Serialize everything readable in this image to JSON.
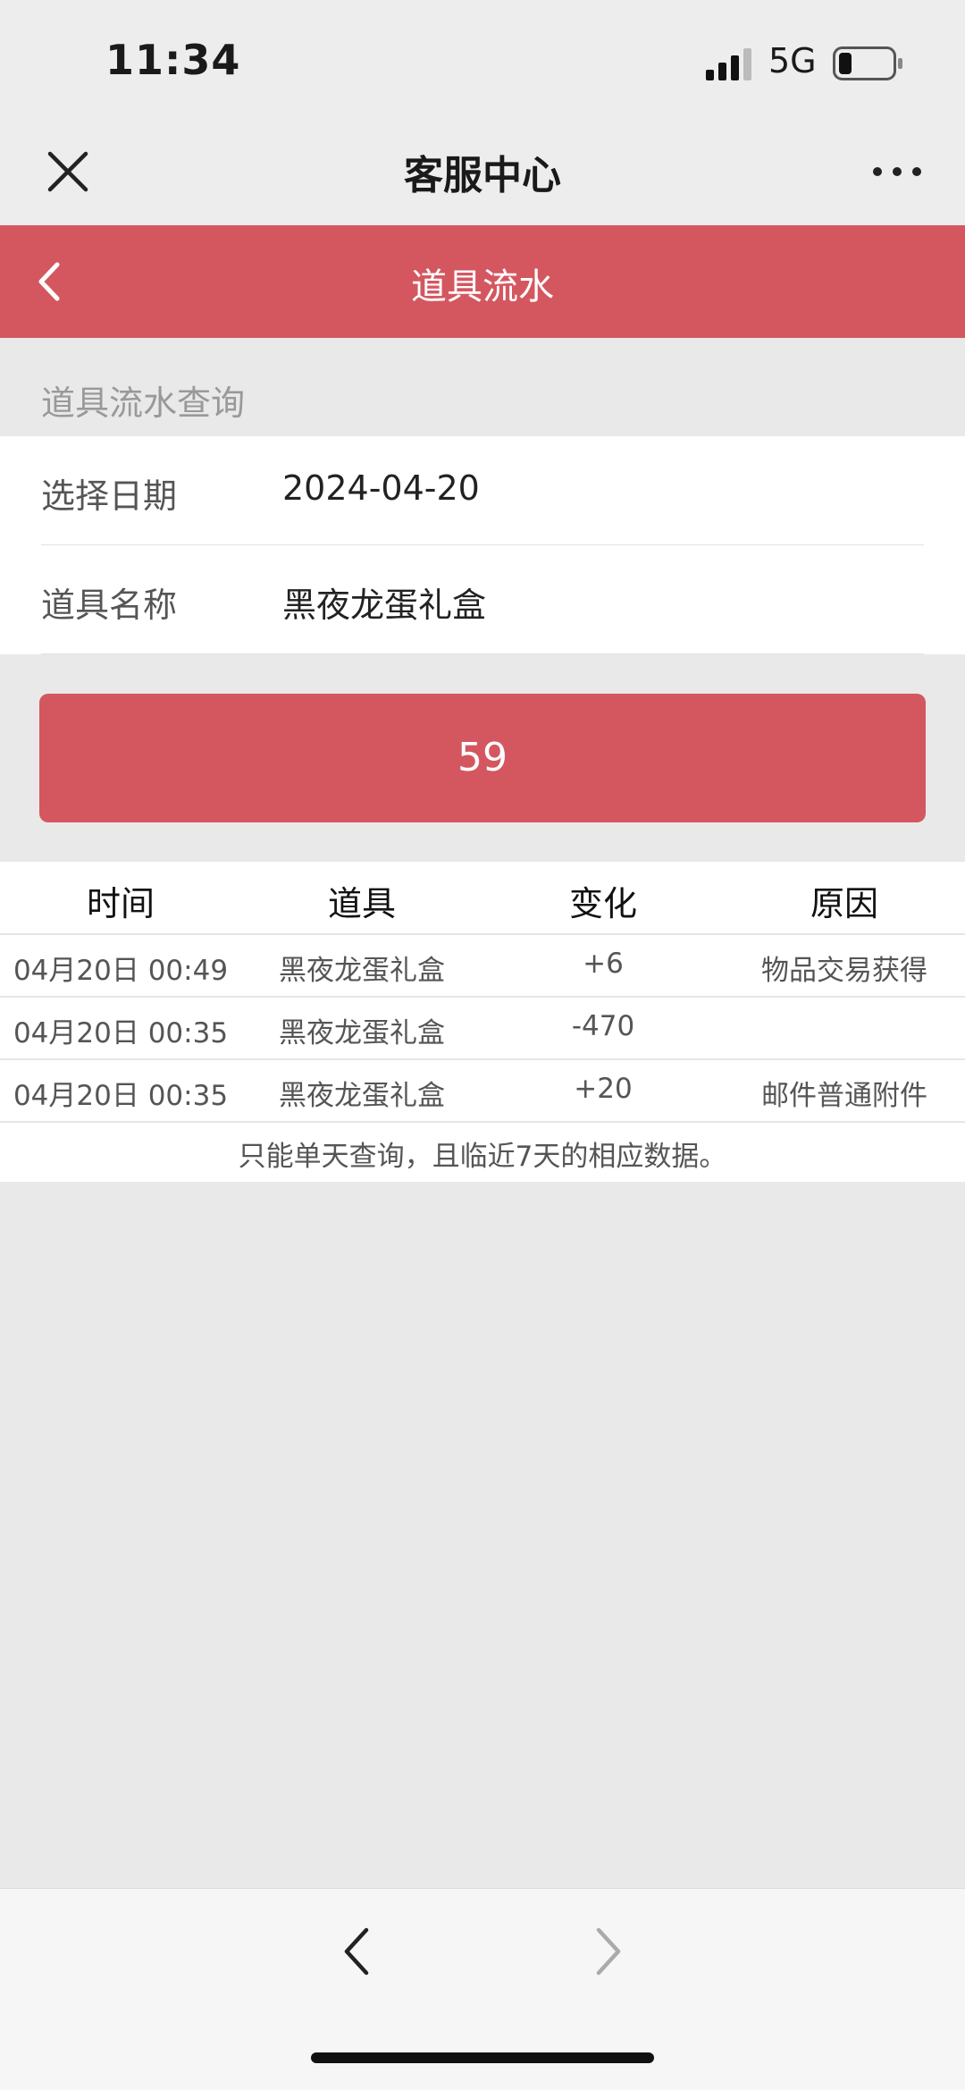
{
  "status_bar": {
    "time": "11:34",
    "network": "5G",
    "icons": [
      "signal-icon",
      "battery-icon"
    ]
  },
  "nav": {
    "title": "客服中心",
    "icons": [
      "close-icon",
      "more-icon"
    ]
  },
  "header": {
    "title": "道具流水",
    "back_icon": "chevron-left-icon",
    "color": "#d45760"
  },
  "query": {
    "section_label": "道具流水查询",
    "date_label": "选择日期",
    "date_value": "2024-04-20",
    "item_label": "道具名称",
    "item_value": "黑夜龙蛋礼盒",
    "button_label": "59"
  },
  "table": {
    "headers": [
      "时间",
      "道具",
      "变化",
      "原因"
    ],
    "rows": [
      [
        "04月20日 00:49",
        "黑夜龙蛋礼盒",
        "+6",
        "物品交易获得"
      ],
      [
        "04月20日 00:35",
        "黑夜龙蛋礼盒",
        "-470",
        ""
      ],
      [
        "04月20日 00:35",
        "黑夜龙蛋礼盒",
        "+20",
        "邮件普通附件"
      ]
    ],
    "note": "只能单天查询，且临近7天的相应数据。"
  },
  "bottom_bar": {
    "icons": [
      "back-arrow-icon",
      "forward-arrow-icon"
    ]
  }
}
